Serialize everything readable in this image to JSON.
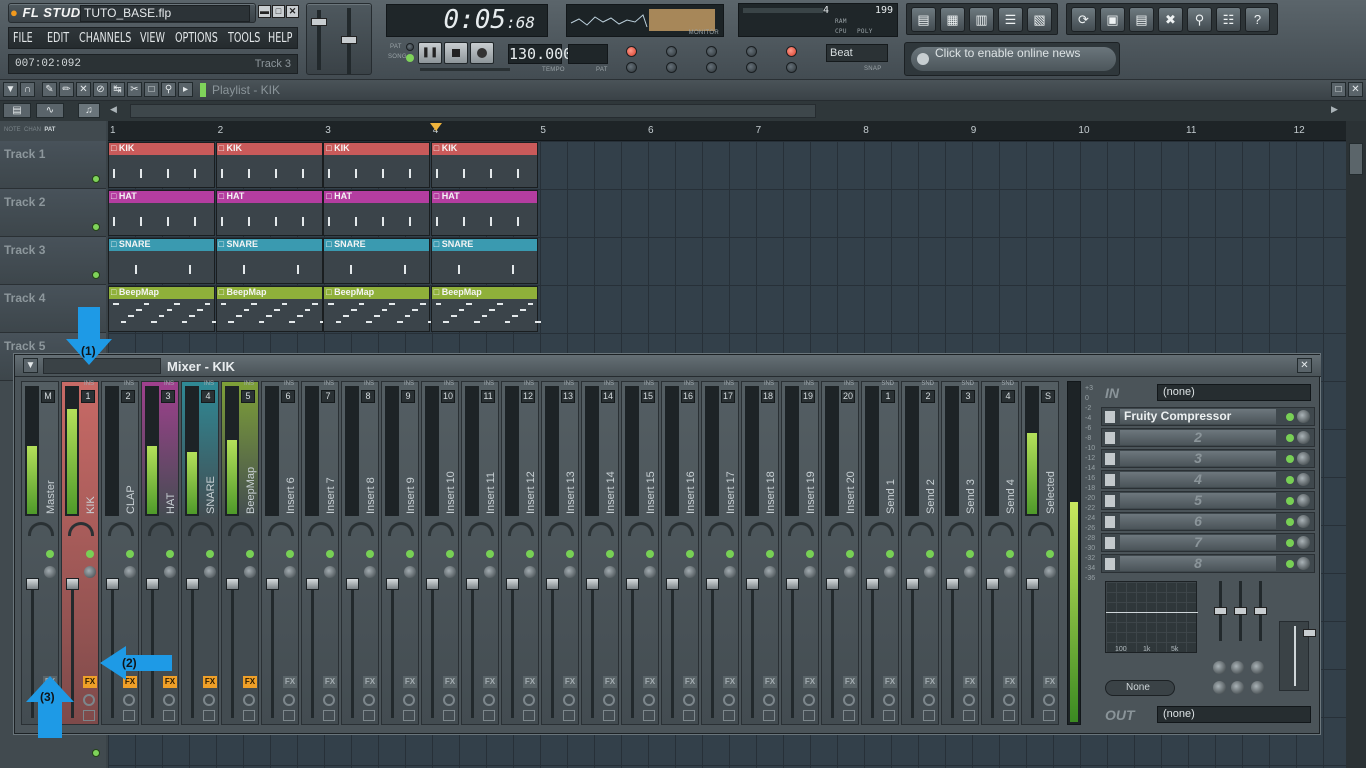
{
  "app": {
    "logo": "FL STUDIO",
    "filename": "TUTO_BASE.flp"
  },
  "menu": [
    "FILE",
    "EDIT",
    "CHANNELS",
    "VIEW",
    "OPTIONS",
    "TOOLS",
    "HELP"
  ],
  "hint": {
    "time": "007:02:092",
    "right": "Track 3"
  },
  "transport": {
    "time": "0:05",
    "time_small": "68",
    "tempo": "130.000",
    "tempo_label": "TEMPO",
    "pat_label": "PAT",
    "pat_mode": "PAT",
    "song_mode": "SONG",
    "monitor_label": "MONITOR"
  },
  "cpu": {
    "poly": "199",
    "cpu_label": "CPU",
    "ram_label": "RAM",
    "poly_label": "POLY",
    "value": "4"
  },
  "snap": {
    "value": "Beat",
    "label": "SNAP"
  },
  "news": {
    "text": "Click to enable online news"
  },
  "playlist": {
    "title": "Playlist - KIK"
  },
  "ruler": [
    "1",
    "2",
    "3",
    "4",
    "5",
    "6",
    "7",
    "8",
    "9",
    "10",
    "11",
    "12"
  ],
  "tracks": [
    "Track 1",
    "Track 2",
    "Track 3",
    "Track 4",
    "Track 5"
  ],
  "clips": [
    {
      "label": "KIK",
      "color": "#c95a5a"
    },
    {
      "label": "HAT",
      "color": "#b43da0"
    },
    {
      "label": "SNARE",
      "color": "#3a9ab0"
    },
    {
      "label": "BeepMap",
      "color": "#8fb03a"
    }
  ],
  "mixer": {
    "title": "Mixer - KIK",
    "strips": [
      "Master",
      "KIK",
      "CLAP",
      "HAT",
      "SNARE",
      "BeepMap",
      "Insert 6",
      "Insert 7",
      "Insert 8",
      "Insert 9",
      "Insert 10",
      "Insert 11",
      "Insert 12",
      "Insert 13",
      "Insert 14",
      "Insert 15",
      "Insert 16",
      "Insert 17",
      "Insert 18",
      "Insert 19",
      "Insert 20",
      "Send 1",
      "Send 2",
      "Send 3",
      "Send 4",
      "Selected"
    ],
    "numbers": [
      "M",
      "1",
      "2",
      "3",
      "4",
      "5",
      "6",
      "7",
      "8",
      "9",
      "10",
      "11",
      "12",
      "13",
      "14",
      "15",
      "16",
      "17",
      "18",
      "19",
      "20",
      "1",
      "2",
      "3",
      "4",
      "S"
    ],
    "strip_type": "INS",
    "send_type": "SND",
    "fx_label": "FX",
    "in_label": "IN",
    "out_label": "OUT",
    "in_value": "(none)",
    "out_value": "(none)",
    "slots": [
      "Fruity Compressor",
      "2",
      "3",
      "4",
      "5",
      "6",
      "7",
      "8"
    ],
    "eq_labels": [
      "100",
      "1k",
      "5k"
    ],
    "none_value": "None",
    "scale": [
      "+3",
      "0",
      "-2",
      "-4",
      "-6",
      "-8",
      "-10",
      "-12",
      "-14",
      "-16",
      "-18",
      "-20",
      "-22",
      "-24",
      "-26",
      "-28",
      "-30",
      "-32",
      "-34",
      "-36"
    ]
  },
  "annotations": [
    "(1)",
    "(2)",
    "(3)"
  ],
  "colors": {
    "accent": "#f0a028",
    "arrow": "#1e9ae6",
    "selected_strip": "#c86a66"
  }
}
